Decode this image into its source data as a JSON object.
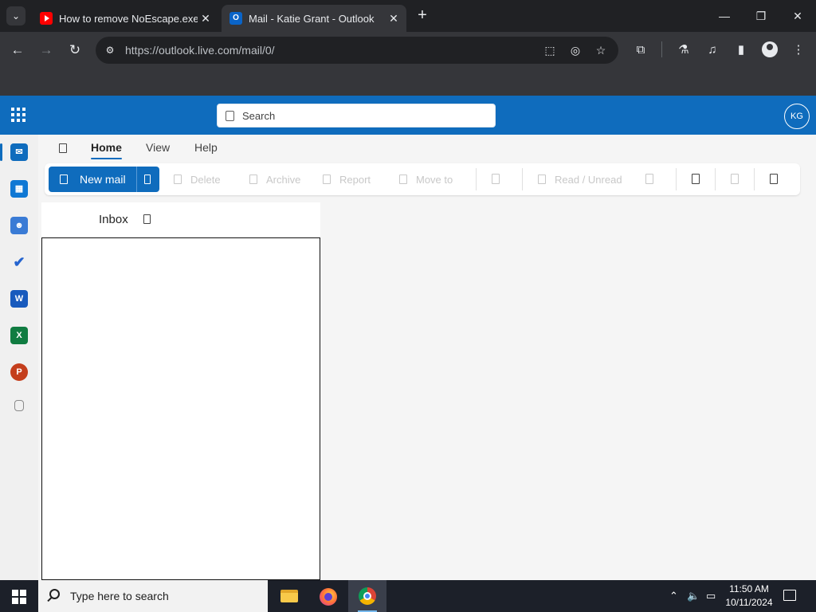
{
  "browser": {
    "tabs": [
      {
        "title": "How to remove NoEscape.exe",
        "close": "✕",
        "active": false
      },
      {
        "title": "Mail - Katie Grant - Outlook",
        "close": "✕",
        "active": true
      }
    ],
    "new_tab": "+",
    "window_controls": {
      "minimize": "—",
      "restore": "❐",
      "close": "✕"
    },
    "url": "https://outlook.live.com/mail/0/",
    "nav": {
      "back": "←",
      "forward": "→",
      "reload": "↻"
    },
    "omnibox_icons": [
      "install-app-icon",
      "eye-off-icon",
      "star-icon"
    ],
    "toolbar_icons": [
      "extensions-icon",
      "labs-icon",
      "media-icon",
      "side-panel-icon",
      "profile-icon",
      "more-icon"
    ]
  },
  "outlook": {
    "search_placeholder": "Search",
    "avatar_initials": "KG",
    "ribbon_tabs": [
      "Home",
      "View",
      "Help"
    ],
    "selected_tab": "Home",
    "new_mail": "New mail",
    "actions": [
      "Delete",
      "Archive",
      "Report",
      "Move to",
      "Read / Unread"
    ],
    "folder_title": "Inbox",
    "rail_apps": [
      "Mail",
      "Calendar",
      "People",
      "To Do",
      "Word",
      "Excel",
      "PowerPoint",
      "More apps"
    ],
    "brand_color": "#0f6cbd"
  },
  "taskbar": {
    "search_placeholder": "Type here to search",
    "pinned": [
      "File Explorer",
      "Firefox",
      "Chrome"
    ],
    "time": "11:50 AM",
    "date": "10/11/2024"
  }
}
